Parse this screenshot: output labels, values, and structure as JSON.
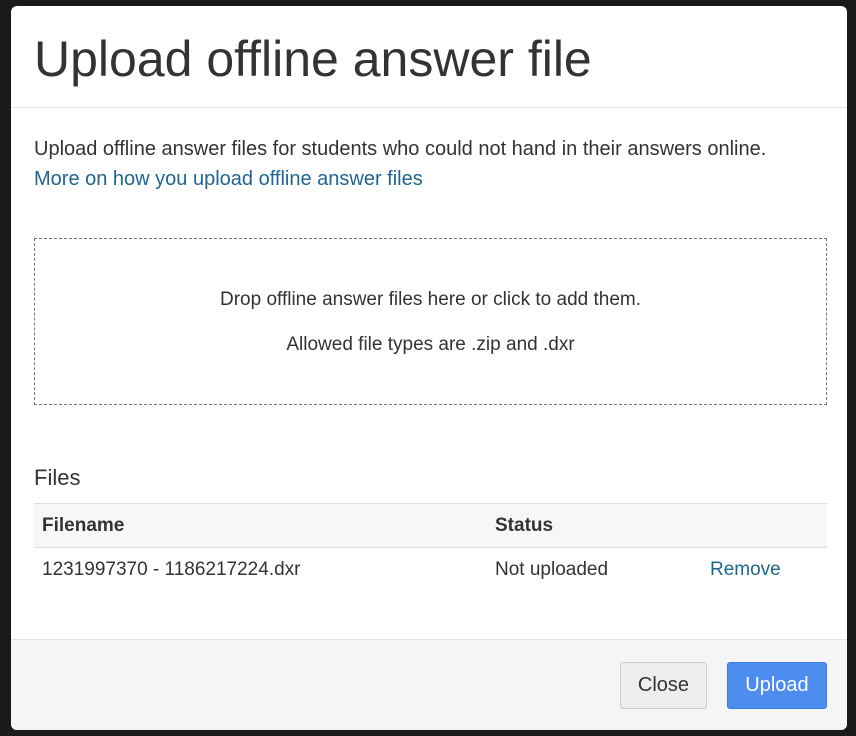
{
  "dialog": {
    "title": "Upload offline answer file"
  },
  "body": {
    "intro": "Upload offline answer files for students who could not hand in their answers online.",
    "help_link": "More on how you upload offline answer files"
  },
  "dropzone": {
    "instruction": "Drop offline answer files here or click to add them.",
    "allowed_types": "Allowed file types are .zip and .dxr"
  },
  "files": {
    "heading": "Files",
    "columns": [
      "Filename",
      "Status",
      ""
    ],
    "rows": [
      {
        "filename": "1231997370 - 1186217224.dxr",
        "status": "Not uploaded",
        "action": "Remove"
      }
    ]
  },
  "footer": {
    "close_label": "Close",
    "upload_label": "Upload"
  },
  "colors": {
    "link": "#1f6592",
    "primary_button": "#4d8df0",
    "backdrop": "#1a1a1a"
  }
}
